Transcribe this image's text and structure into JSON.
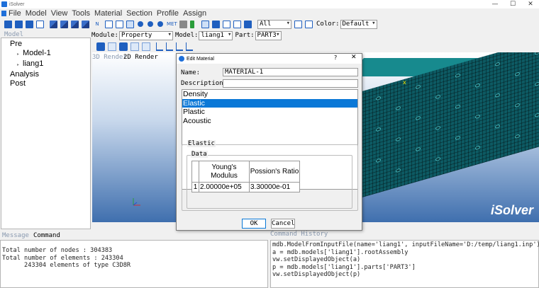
{
  "window": {
    "title": "iSolver",
    "minimize": "—",
    "maximize": "☐",
    "close": "✕"
  },
  "menu": [
    "File",
    "Model",
    "View",
    "Tools",
    "Material",
    "Section",
    "Profile",
    "Assign"
  ],
  "toolbar": {
    "text_icon": "MET",
    "filter_value": "All",
    "color_label": "Color:",
    "color_value": "Default"
  },
  "module_bar": {
    "module_label": "Module:",
    "module_value": "Property",
    "model_label": "Model:",
    "model_value": "liang1",
    "part_label": "Part:",
    "part_value": "PART3"
  },
  "tree": {
    "title": "Model",
    "nodes": [
      {
        "label": "Pre",
        "level": 0,
        "expander": ""
      },
      {
        "label": "Model-1",
        "level": 1,
        "expander": "▸"
      },
      {
        "label": "liang1",
        "level": 1,
        "expander": "▸"
      },
      {
        "label": "Analysis",
        "level": 0,
        "expander": ""
      },
      {
        "label": "Post",
        "level": 0,
        "expander": ""
      }
    ]
  },
  "viewport": {
    "tab_3d": "3D Render",
    "tab_2d": "2D Render",
    "brand": "iSolver",
    "marker": "x"
  },
  "messages": {
    "tab_message": "Message",
    "tab_command": "Command",
    "lines": [
      "Total number of nodes : 304383",
      "Total number of elements : 243304",
      "      243304 elements of type C3D8R"
    ]
  },
  "history": {
    "title": "Command History",
    "lines": [
      "mdb.ModelFromInputFile(name='liang1', inputFileName='D:/temp/liang1.inp')",
      "a = mdb.models['liang1'].rootAssembly",
      "vw.setDisplayedObject(a)",
      "p = mdb.models['liang1'].parts['PART3']",
      "vw.setDisplayedObject(p)"
    ]
  },
  "dialog": {
    "title": "Edit Material",
    "help": "?",
    "close": "✕",
    "name_label": "Name:",
    "name_value": "MATERIAL-1",
    "description_label": "Description:",
    "description_value": "",
    "properties": [
      "Density",
      "Elastic",
      "Plastic",
      "Acoustic"
    ],
    "selected_index": 1,
    "group_elastic": "Elastic",
    "group_data": "Data",
    "table": {
      "headers": [
        "Young's Modulus",
        "Possion's Ratio"
      ],
      "rows": [
        {
          "index": "1",
          "cells": [
            "2.00000e+05",
            "3.30000e-01"
          ]
        }
      ]
    },
    "ok_label": "OK",
    "cancel_label": "Cancel"
  },
  "colors": {
    "accent": "#0a78d7",
    "mesh": "#0d5a63",
    "toolbar_icon": "#1f5fbf"
  }
}
